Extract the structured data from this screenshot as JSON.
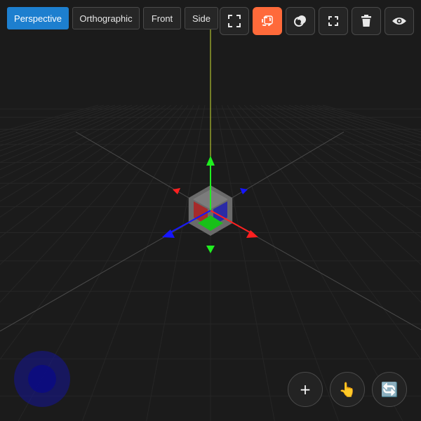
{
  "view_modes": {
    "perspective": "Perspective",
    "orthographic": "Orthographic",
    "front": "Front",
    "side": "Side",
    "active": "perspective"
  },
  "toolbar": {
    "icons": [
      "fullscreen-icon",
      "select-mode-icon",
      "blend-mode-icon",
      "focus-icon",
      "trash-icon",
      "eye-icon"
    ],
    "active_tool": "select-mode-icon"
  },
  "action_buttons": {
    "add": "+",
    "pointer": "👆",
    "rotate": "🔄"
  },
  "colors": {
    "accent_blue": "#1d7fcf",
    "accent_orange": "#ff6a3a",
    "axis_x": "#ff2020",
    "axis_y": "#20ee20",
    "axis_z": "#1515ff",
    "joystick": "#14149a"
  }
}
